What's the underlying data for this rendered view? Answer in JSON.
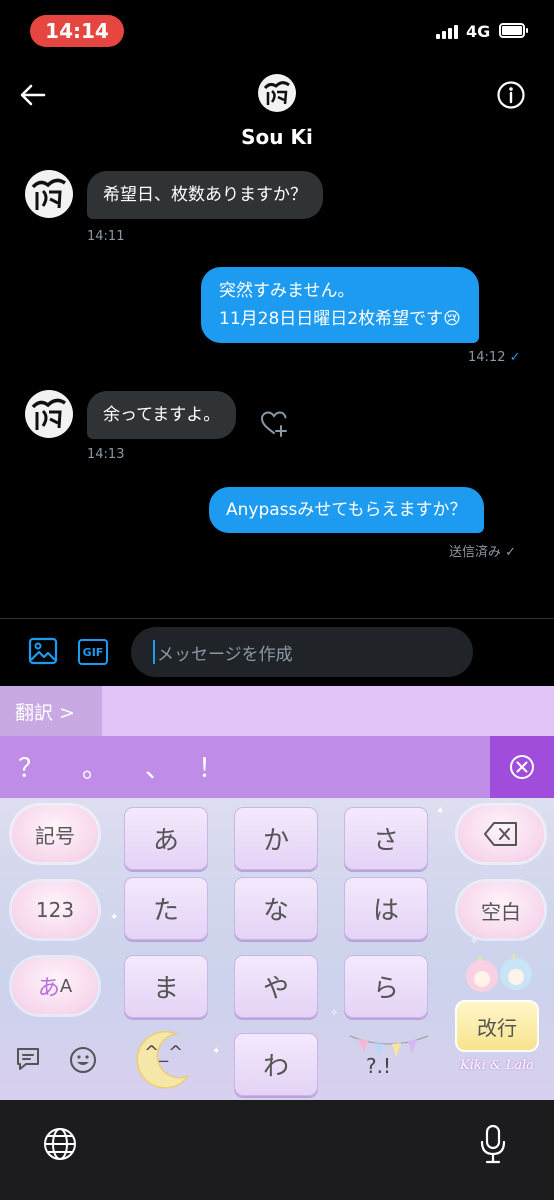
{
  "status_bar": {
    "time": "14:14",
    "network": "4G"
  },
  "header": {
    "name": "Sou Ki"
  },
  "messages": [
    {
      "dir": "in",
      "text": "希望日、枚数ありますか？",
      "time": "14:11"
    },
    {
      "dir": "out",
      "lines": [
        "突然すみません。",
        "11月28日日曜日2枚希望です"
      ],
      "emoji": "😢",
      "time": "14:12",
      "check": "✓"
    },
    {
      "dir": "in",
      "text": "余ってますよ。",
      "time": "14:13"
    },
    {
      "dir": "out",
      "text": "Anypassみせてもらえますか？",
      "status": "送信済み",
      "check": "✓"
    }
  ],
  "composer": {
    "placeholder": "メッセージを作成",
    "gif_label": "GIF"
  },
  "keyboard": {
    "translate_label": "翻訳 >",
    "punctuation": [
      "？",
      "。",
      "、",
      "！"
    ],
    "keys_row1": [
      "あ",
      "か",
      "さ"
    ],
    "keys_row2": [
      "た",
      "な",
      "は"
    ],
    "keys_row3": [
      "ま",
      "や",
      "ら"
    ],
    "keys_row4": [
      "わ"
    ],
    "kigou": "記号",
    "num": "123",
    "kana_a": "あ",
    "kana_A": "A",
    "space": "空白",
    "return": "改行",
    "dakuten_key": "^_^",
    "punct_key": "?.!",
    "brand_text": "Kiki & Lala",
    "accent_color": "#1d9bf0",
    "keyboard_accent": "#bf8ce8"
  }
}
